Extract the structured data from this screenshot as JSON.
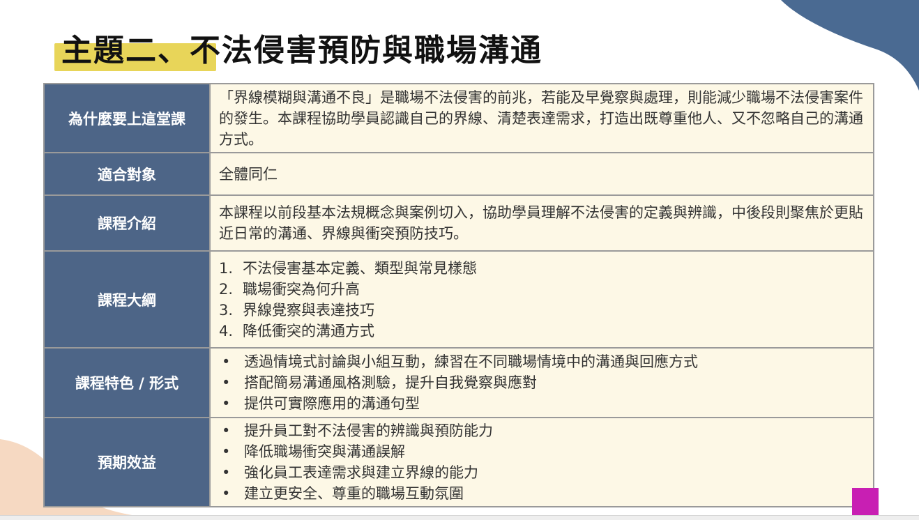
{
  "title": "主題二、不法侵害預防與職場溝通",
  "colors": {
    "label_bg": "#4d6587",
    "content_bg": "#fdf8e6",
    "highlight": "#e8d559",
    "corner_blue": "#4a6a92",
    "corner_peach": "#f6d9c2",
    "accent_pink": "#c81fb3"
  },
  "rows": [
    {
      "label": "為什麼要上這堂課",
      "text": "「界線模糊與溝通不良」是職場不法侵害的前兆，若能及早覺察與處理，則能減少職場不法侵害案件的發生。本課程協助學員認識自己的界線、清楚表達需求，打造出既尊重他人、又不忽略自己的溝通方式。"
    },
    {
      "label": "適合對象",
      "text": "全體同仁"
    },
    {
      "label": "課程介紹",
      "text": "本課程以前段基本法規概念與案例切入，協助學員理解不法侵害的定義與辨識，中後段則聚焦於更貼近日常的溝通、界線與衝突預防技巧。"
    },
    {
      "label": "課程大綱",
      "items": [
        {
          "marker": "1.",
          "text": "不法侵害基本定義、類型與常見樣態"
        },
        {
          "marker": "2.",
          "text": "職場衝突為何升高"
        },
        {
          "marker": "3.",
          "text": "界線覺察與表達技巧"
        },
        {
          "marker": "4.",
          "text": "降低衝突的溝通方式"
        }
      ]
    },
    {
      "label": "課程特色 / 形式",
      "items": [
        {
          "marker": "•",
          "text": "透過情境式討論與小組互動，練習在不同職場情境中的溝通與回應方式"
        },
        {
          "marker": "•",
          "text": "搭配簡易溝通風格測驗，提升自我覺察與應對"
        },
        {
          "marker": "•",
          "text": "提供可實際應用的溝通句型"
        }
      ]
    },
    {
      "label": "預期效益",
      "items": [
        {
          "marker": "•",
          "text": "提升員工對不法侵害的辨識與預防能力"
        },
        {
          "marker": "•",
          "text": "降低職場衝突與溝通誤解"
        },
        {
          "marker": "•",
          "text": "強化員工表達需求與建立界線的能力"
        },
        {
          "marker": "•",
          "text": "建立更安全、尊重的職場互動氛圍"
        }
      ]
    }
  ]
}
